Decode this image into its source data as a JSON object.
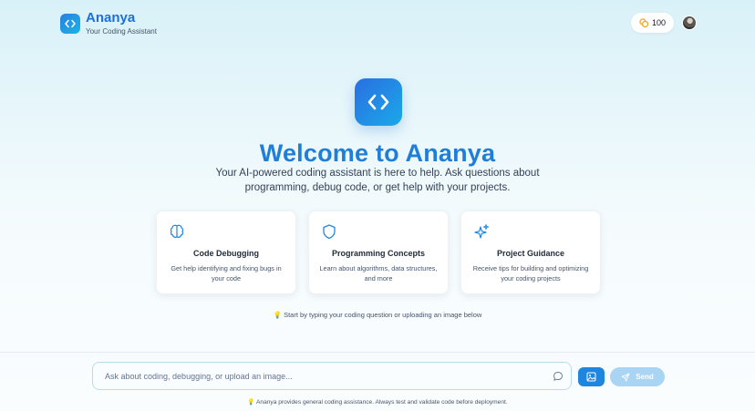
{
  "header": {
    "brand_name": "Ananya",
    "brand_sub": "Your Coding Assistant",
    "credits": "100",
    "credits_icon": "coins-icon"
  },
  "hero": {
    "title": "Welcome to Ananya",
    "subtitle": "Your AI-powered coding assistant is here to help. Ask questions about programming, debug code, or get help with your projects."
  },
  "cards": [
    {
      "title": "Code Debugging",
      "desc": "Get help identifying and fixing bugs in your code",
      "icon": "brain-icon"
    },
    {
      "title": "Programming Concepts",
      "desc": "Learn about algorithms, data structures, and more",
      "icon": "shield-icon"
    },
    {
      "title": "Project Guidance",
      "desc": "Receive tips for building and optimizing your coding projects",
      "icon": "sparkles-icon"
    }
  ],
  "hint": "💡 Start by typing your coding question or uploading an image below",
  "composer": {
    "placeholder": "Ask about coding, debugging, or upload an image...",
    "send_label": "Send"
  },
  "footer": "💡 Ananya provides general coding assistance. Always test and validate code before deployment.",
  "colors": {
    "accent": "#1f7fd8",
    "send_disabled": "#a9d4f3",
    "card_icon": "#1f86e0"
  }
}
